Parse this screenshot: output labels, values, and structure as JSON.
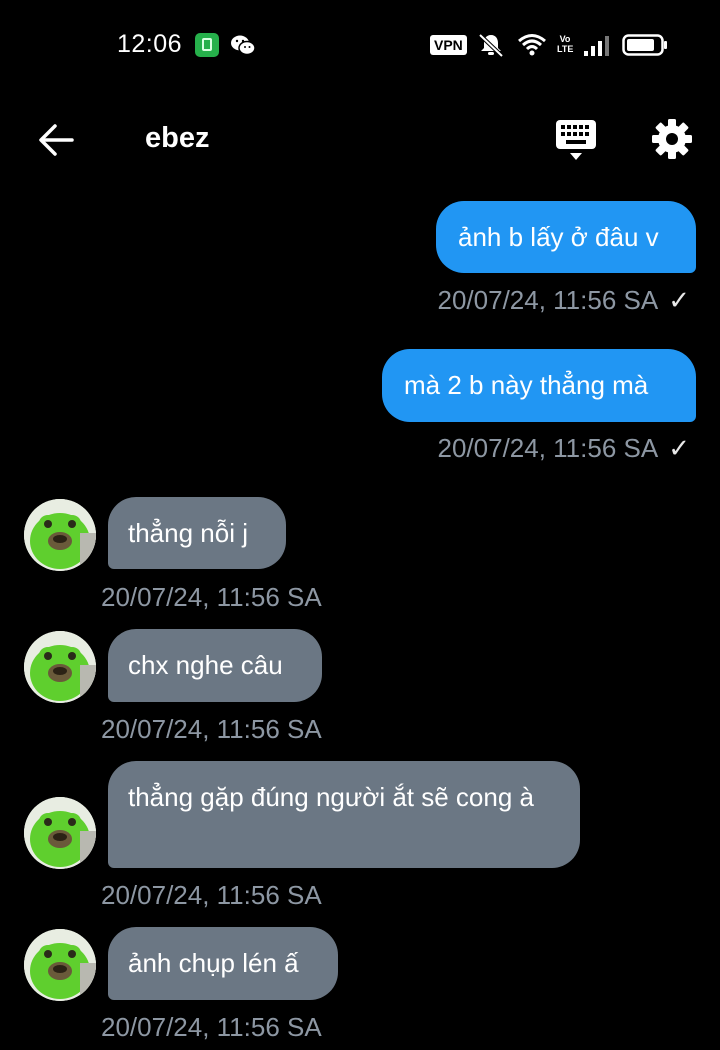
{
  "status": {
    "time": "12:06",
    "vpn": "VPN",
    "volte_top": "Vo",
    "volte_bottom": "LTE"
  },
  "header": {
    "title": "ebez"
  },
  "colors": {
    "outgoing_bubble": "#2196f3",
    "incoming_bubble": "#6b7784",
    "timestamp": "#8d97a3",
    "background": "#000000"
  },
  "messages": [
    {
      "direction": "out",
      "text": "ảnh b lấy ở đâu v",
      "time": "20/07/24, 11:56 SA",
      "read_check": "✓"
    },
    {
      "direction": "out",
      "text": "mà 2 b này thẳng mà",
      "time": "20/07/24, 11:56 SA",
      "read_check": "✓"
    },
    {
      "direction": "in",
      "text": "thẳng nỗi j",
      "time": "20/07/24, 11:56 SA"
    },
    {
      "direction": "in",
      "text": "chx nghe câu",
      "time": "20/07/24, 11:56 SA"
    },
    {
      "direction": "in",
      "text": "thẳng gặp đúng người ắt sẽ cong à",
      "time": "20/07/24, 11:56 SA"
    },
    {
      "direction": "in",
      "text": "ảnh chụp lén ấ",
      "time": "20/07/24, 11:56 SA"
    }
  ]
}
